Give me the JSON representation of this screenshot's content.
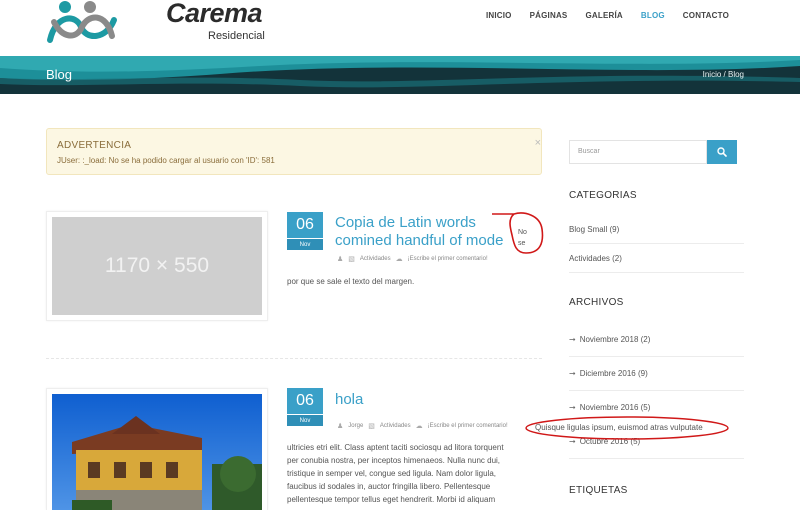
{
  "header": {
    "logo_text": "Carema",
    "logo_sub": "Residencial",
    "nav": [
      "INICIO",
      "PÁGINAS",
      "GALERÍA",
      "BLOG",
      "CONTACTO"
    ],
    "active_nav": "BLOG"
  },
  "banner": {
    "title": "Blog",
    "breadcrumb_home": "Inicio",
    "breadcrumb_sep": " / ",
    "breadcrumb_current": "Blog"
  },
  "warning": {
    "title": "ADVERTENCIA",
    "message": "JUser: :_load: No se ha podido cargar al usuario con 'ID': 581",
    "close": "×"
  },
  "posts": [
    {
      "thumb_placeholder": "1170 × 550",
      "day": "06",
      "month": "Nov",
      "title_line1": "Copia de Latin words",
      "title_line2": "comined handful of mode",
      "author": "",
      "category": "Actividades",
      "comments": "¡Escribe el primer comentario!",
      "excerpt": "por que se sale el texto del margen."
    },
    {
      "day": "06",
      "month": "Nov",
      "title": "hola",
      "author": "Jorge",
      "category": "Actividades",
      "comments": "¡Escribe el primer comentario!",
      "excerpt": [
        "ultricies etri elit. Class aptent taciti sociosqu ad litora torquent",
        "per conubia nostra, per inceptos himenaeos. Nulla nunc dui,",
        "tristique in semper vel, congue sed ligula. Nam dolor ligula,",
        "faucibus id sodales in, auctor fringilla libero. Pellentesque",
        "pellentesque tempor tellus eget hendrerit. Morbi id aliquam"
      ]
    }
  ],
  "annotations": {
    "note1_line1": "No",
    "note1_line2": "se",
    "overflow_text": "Quisque ligulas ipsum, euismod atras vulputate"
  },
  "sidebar": {
    "search_placeholder": "Buscar",
    "categories_title": "CATEGORIAS",
    "categories": [
      "Blog Small (9)",
      "Actividades (2)"
    ],
    "archives_title": "ARCHIVOS",
    "archives": [
      "Noviembre 2018 (2)",
      "Diciembre 2016 (9)",
      "Noviembre 2016 (5)",
      "Octubre 2016 (5)"
    ],
    "tags_title": "ETIQUETAS"
  },
  "colors": {
    "accent": "#3aa0c8",
    "banner_dark": "#13333a",
    "banner_teal": "#1d8f99",
    "warning_bg": "#fcf7e3",
    "annotation_red": "#d01818"
  }
}
